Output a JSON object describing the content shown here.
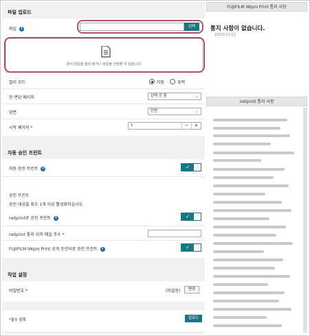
{
  "file_upload": {
    "title": "파일 업로드",
    "file_label": "파일",
    "select_button": "선택",
    "drop_text": "문서 파일을 끌어 놓거나 파일을 선택할 수 있습니다."
  },
  "settings": {
    "color_mode_label": "컬러 모드",
    "color_options": [
      "자동",
      "흑백"
    ],
    "color_selected": "자동",
    "pages_per_sheet_label": "한 면당 페이지",
    "pages_per_sheet_value": "선택 안 함",
    "duplex_label": "양면",
    "duplex_value": "단면",
    "start_page_label": "시작 페이지 *",
    "start_page_value": "1"
  },
  "auto_print": {
    "title": "자동 승인 프린트",
    "auto_label": "자동 승인 프린트",
    "auto_on": true,
    "approval_heading": "승인 프린트",
    "approval_note": "승인 대상을 최소 1개 이상 활성화하십시오.",
    "netprint_approval_label": "netprint로 승인 프린트",
    "netprint_approval_on": true,
    "email_label": "netprint 통지 위치 메일 주소 *",
    "email_value": "",
    "fujifilm_label": "FUJIFILM IWpro Print 공개 프린터로 승인 프린트",
    "fujifilm_on": true
  },
  "job_settings": {
    "title": "작업 설정",
    "password_label": "비밀번호 *",
    "password_status": "(미설정)",
    "change_button": "변경"
  },
  "footer": {
    "required_note": "*필수 항목",
    "upload_button": "업로드"
  },
  "notices": {
    "fujifilm_header": "FUJIFILM IWpro Print 통지 사항",
    "no_notice": "통지 사항이 없습니다.",
    "date": "2023/12/21",
    "netprint_header": "netprint 통지 사항"
  },
  "colors": {
    "accent": "#1a7585",
    "highlight": "#a8536e",
    "info_icon": "#1b6ea6"
  }
}
